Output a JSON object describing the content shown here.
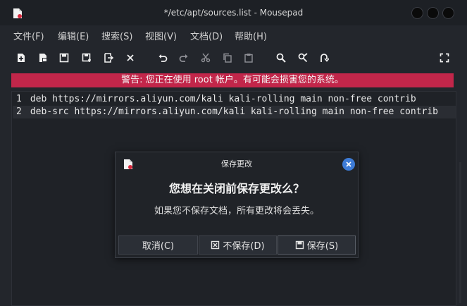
{
  "window": {
    "title": "*/etc/apt/sources.list - Mousepad",
    "app_icon": "mousepad-icon"
  },
  "menu": [
    "文件(F)",
    "编辑(E)",
    "搜索(S)",
    "视图(V)",
    "文档(D)",
    "帮助(H)"
  ],
  "toolbar": {
    "icons": [
      "new-document-icon",
      "new-window-icon",
      "save-icon",
      "save-as-icon",
      "revert-icon",
      "close-tab-icon",
      "undo-icon",
      "redo-icon",
      "cut-icon",
      "copy-icon",
      "paste-icon",
      "search-icon",
      "find-replace-icon",
      "go-to-line-icon",
      "fullscreen-icon"
    ]
  },
  "warning": "警告: 您正在使用 root 帐户。有可能会损害您的系统。",
  "editor": {
    "lines": [
      {
        "num": "1",
        "text": "deb https://mirrors.aliyun.com/kali kali-rolling main non-free contrib"
      },
      {
        "num": "2",
        "text": "deb-src https://mirrors.aliyun.com/kali kali-rolling main non-free contrib"
      }
    ]
  },
  "dialog": {
    "title": "保存更改",
    "heading": "您想在关闭前保存更改么？",
    "body": "如果您不保存文档，所有更改将会丢失。",
    "buttons": {
      "cancel": "取消(C)",
      "dont_save": "不保存(D)",
      "save": "保存(S)"
    }
  },
  "colors": {
    "warning_bg": "#c2264a",
    "accent": "#3d7bd6"
  }
}
